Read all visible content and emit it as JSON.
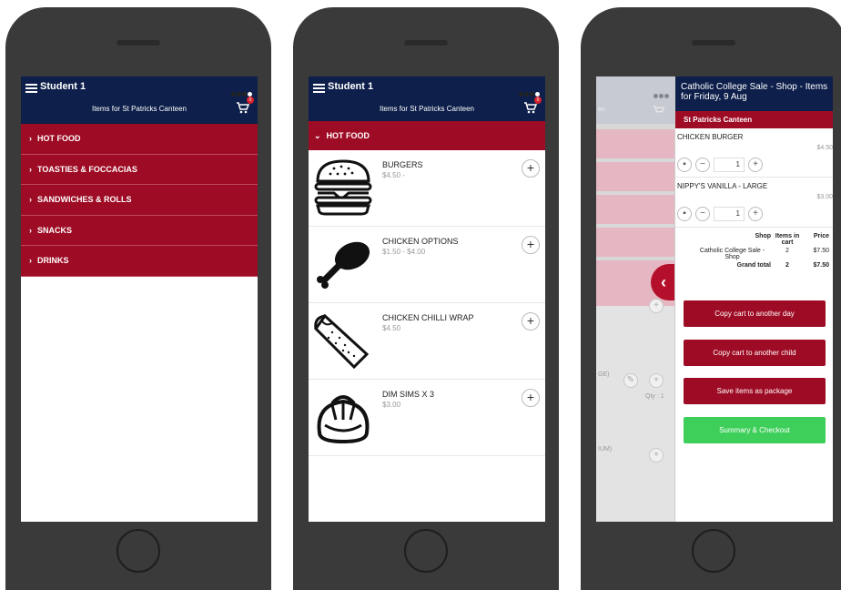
{
  "app": {
    "student": "Student 1",
    "subtitle": "Items for St Patricks Canteen",
    "cart_count": "0"
  },
  "screen1": {
    "categories": [
      {
        "label": "HOT FOOD"
      },
      {
        "label": "TOASTIES & FOCCACIAS"
      },
      {
        "label": "SANDWICHES & ROLLS"
      },
      {
        "label": "SNACKS"
      },
      {
        "label": "DRINKS"
      }
    ]
  },
  "screen2": {
    "category": "HOT FOOD",
    "products": [
      {
        "name": "BURGERS",
        "price": "$4.50 -",
        "icon": "burger-icon"
      },
      {
        "name": "CHICKEN OPTIONS",
        "price": "$1.50 - $4.00",
        "icon": "drumstick-icon"
      },
      {
        "name": "CHICKEN CHILLI WRAP",
        "price": "$4.50",
        "icon": "wrap-icon"
      },
      {
        "name": "DIM SIMS X 3",
        "price": "$3.00",
        "icon": "dumpling-icon"
      }
    ]
  },
  "screen3": {
    "background": {
      "top_text": "en",
      "text1": "GE)",
      "text2": "Qty : 1",
      "text3": "IUM)"
    },
    "title": "Catholic College Sale - Shop - Items for Friday, 9 Aug",
    "shop": "St Patricks Canteen",
    "cart_items": [
      {
        "name": "CHICKEN BURGER",
        "price": "$4.50",
        "qty": "1"
      },
      {
        "name": "NIPPY'S VANILLA - LARGE",
        "price": "$3.00",
        "qty": "1"
      }
    ],
    "summary": {
      "headers": {
        "shop": "Shop",
        "items": "Items in cart",
        "price": "Price"
      },
      "rows": [
        {
          "shop": "Catholic College Sale - Shop",
          "items": "2",
          "price": "$7.50"
        }
      ],
      "total": {
        "label": "Grand total",
        "items": "2",
        "price": "$7.50"
      }
    },
    "buttons": {
      "copy_day": "Copy cart to another day",
      "copy_child": "Copy cart to another child",
      "save_package": "Save items as package",
      "checkout": "Summary & Checkout"
    },
    "colors": {
      "navy": "#0d1f4a",
      "crimson": "#9e0b24",
      "green": "#3ecf5a"
    }
  }
}
